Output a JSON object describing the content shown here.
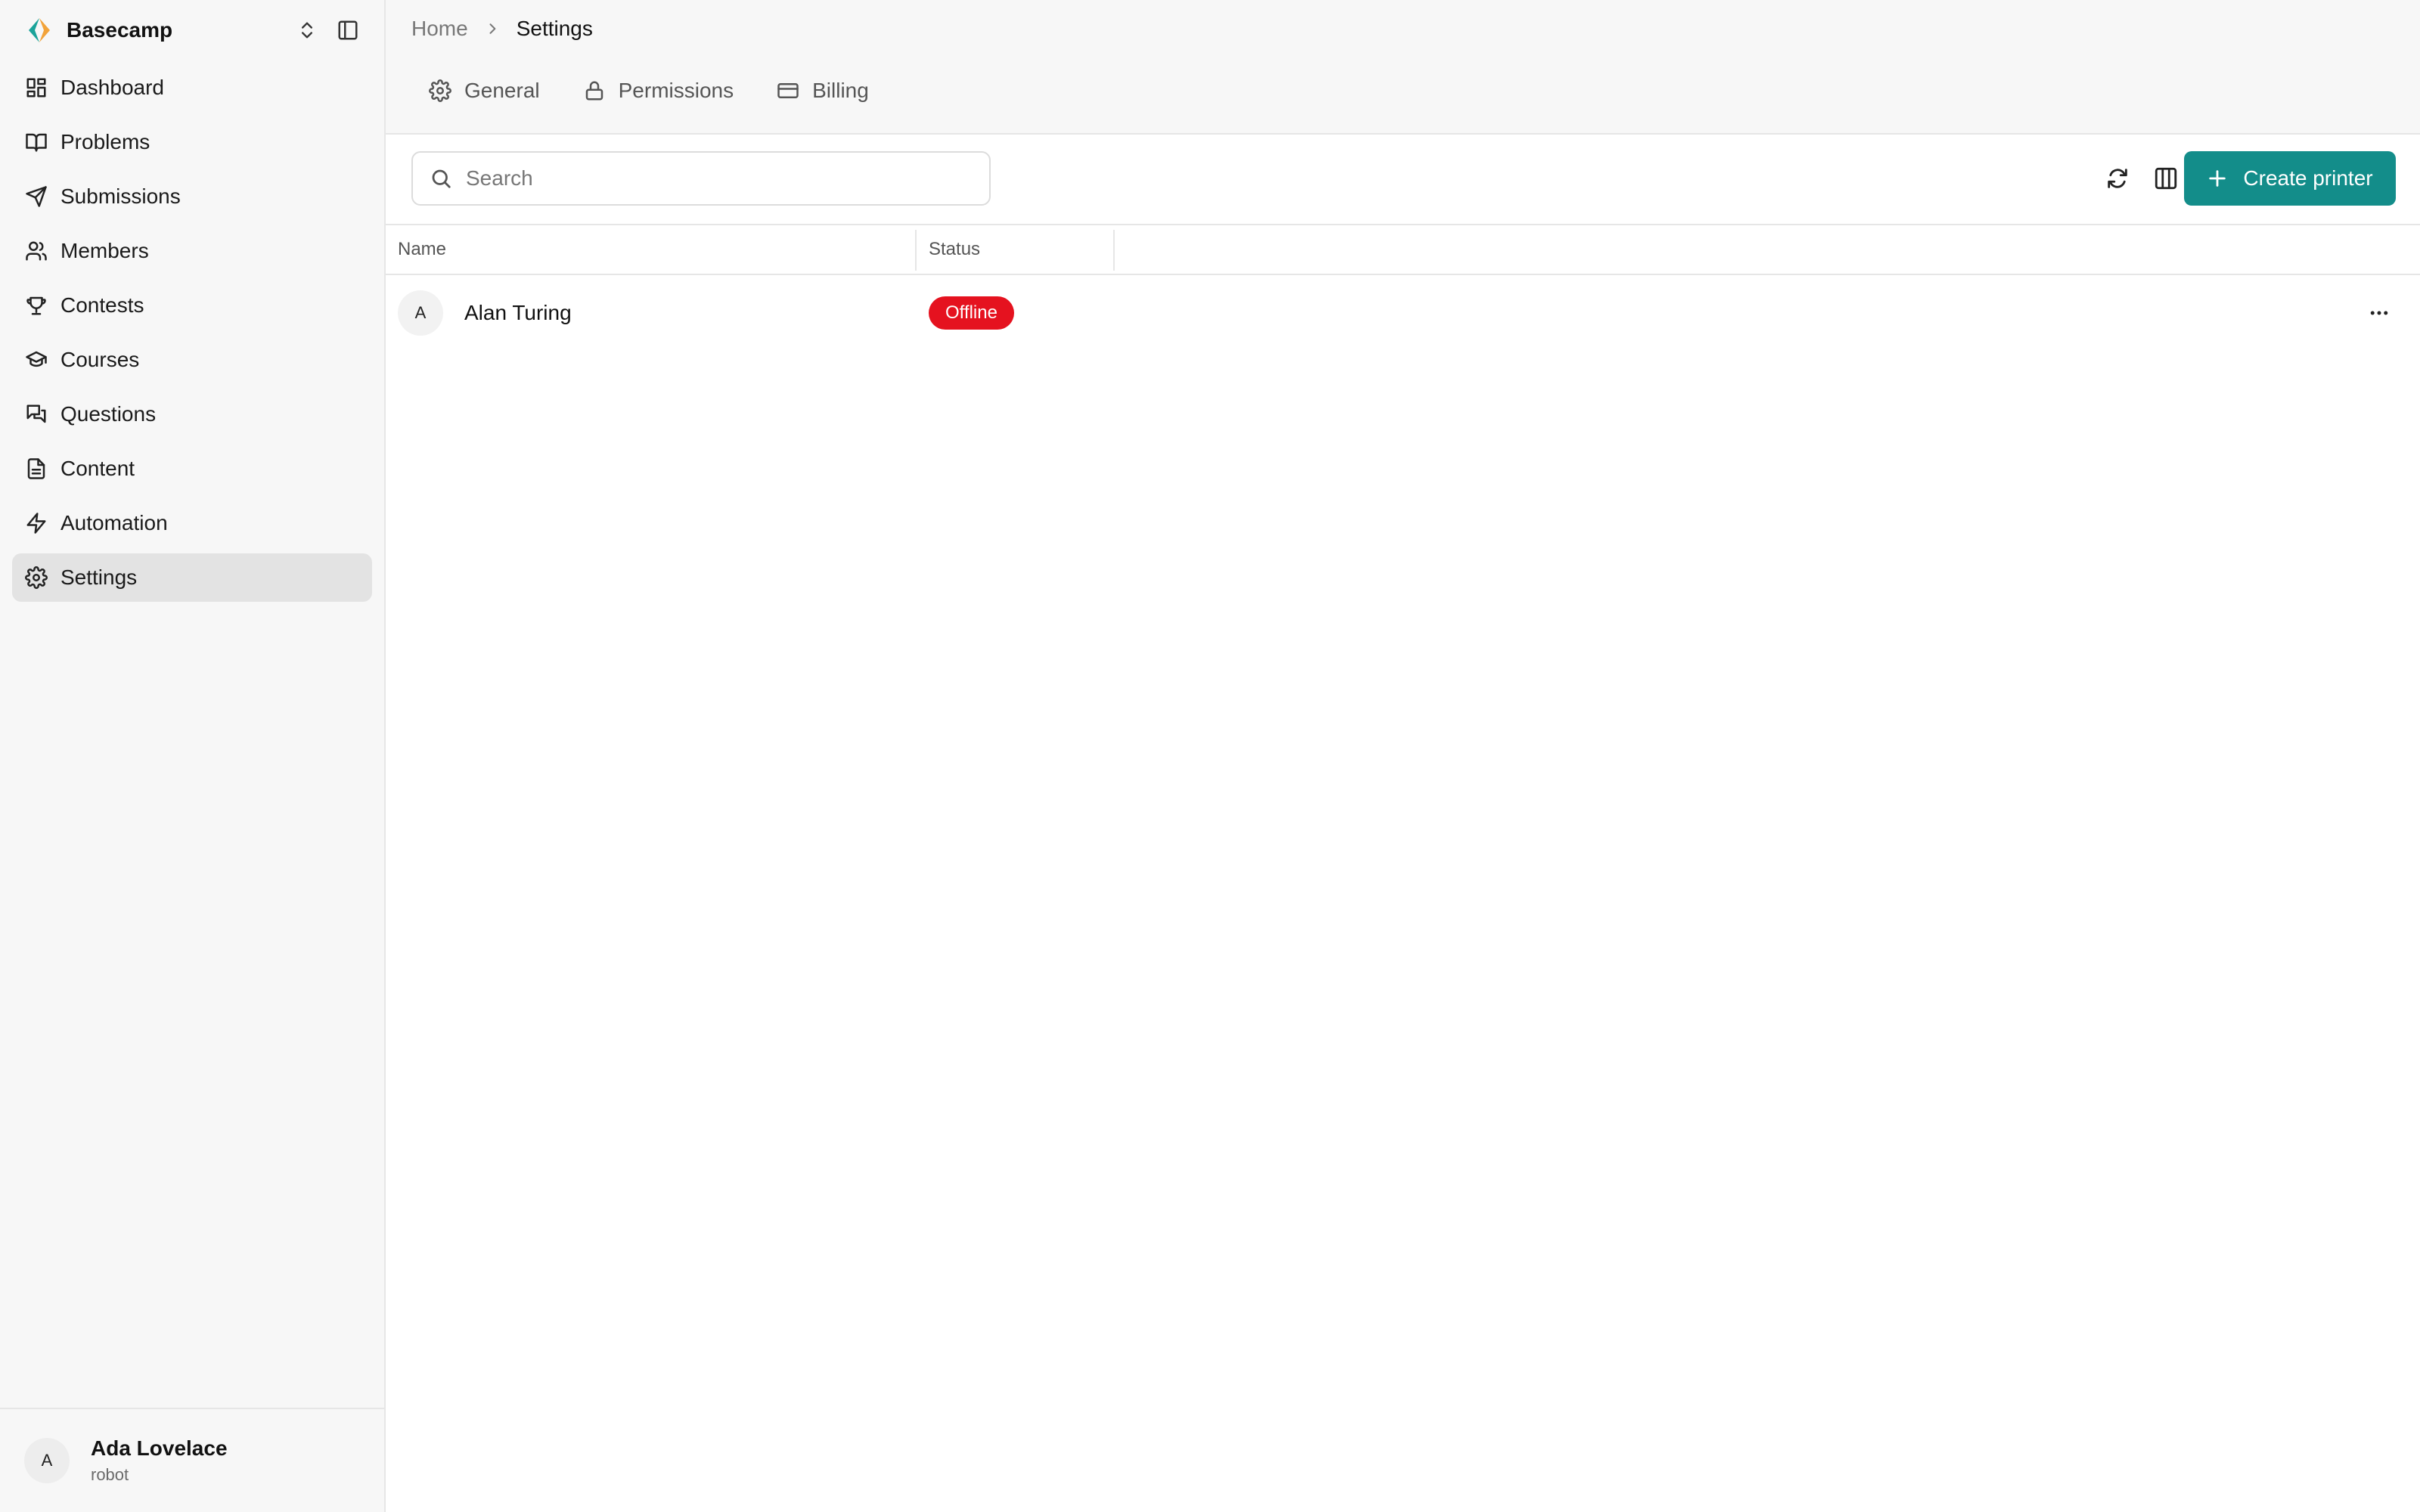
{
  "workspace": {
    "name": "Basecamp"
  },
  "sidebar": {
    "items": [
      {
        "label": "Dashboard",
        "icon": "dashboard-icon"
      },
      {
        "label": "Problems",
        "icon": "book-icon"
      },
      {
        "label": "Submissions",
        "icon": "send-icon"
      },
      {
        "label": "Members",
        "icon": "users-icon"
      },
      {
        "label": "Contests",
        "icon": "trophy-icon"
      },
      {
        "label": "Courses",
        "icon": "graduation-cap-icon"
      },
      {
        "label": "Questions",
        "icon": "messages-icon"
      },
      {
        "label": "Content",
        "icon": "file-text-icon"
      },
      {
        "label": "Automation",
        "icon": "zap-icon"
      },
      {
        "label": "Settings",
        "icon": "gear-icon",
        "active": true
      }
    ]
  },
  "user": {
    "initial": "A",
    "name": "Ada Lovelace",
    "role": "robot"
  },
  "breadcrumb": {
    "home": "Home",
    "current": "Settings"
  },
  "tabs": [
    {
      "label": "General",
      "icon": "gear-icon"
    },
    {
      "label": "Permissions",
      "icon": "lock-icon"
    },
    {
      "label": "Billing",
      "icon": "credit-card-icon"
    }
  ],
  "toolbar": {
    "search_placeholder": "Search",
    "create_label": "Create printer"
  },
  "table": {
    "columns": [
      "Name",
      "Status"
    ],
    "rows": [
      {
        "initial": "A",
        "name": "Alan Turing",
        "status": "Offline"
      }
    ]
  },
  "colors": {
    "accent": "#138d8a",
    "status_offline": "#e5121f",
    "logo_teal": "#1aa39a",
    "logo_orange": "#f2a33a"
  }
}
